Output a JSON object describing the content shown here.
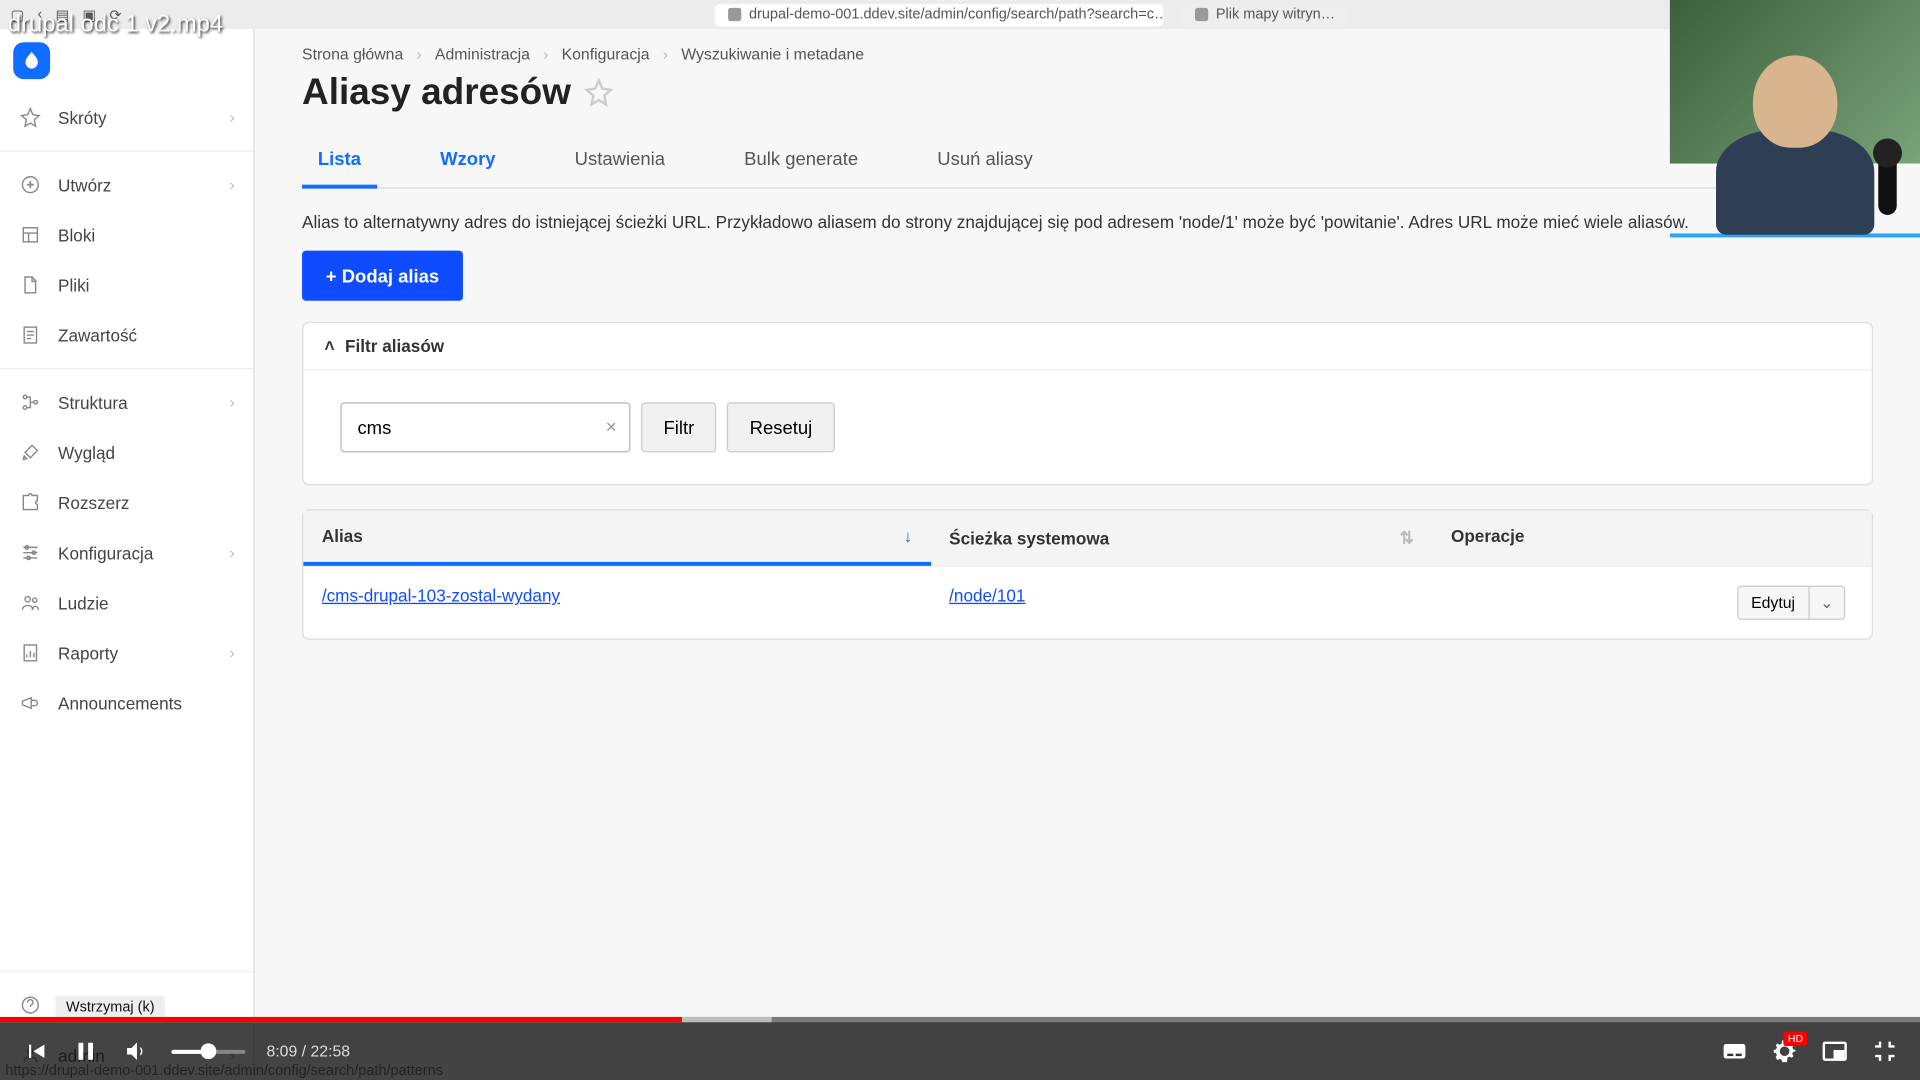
{
  "overlay_title": "drupal odc 1 v2.mp4",
  "browser_tabs": [
    {
      "label": "drupal-demo-001.ddev.site/admin/config/search/path?search=c…"
    },
    {
      "label": "Plik mapy witryn…"
    }
  ],
  "sidebar": {
    "items": [
      {
        "label": "Skróty",
        "has_chev": true,
        "icon": "star"
      },
      {
        "label": "Utwórz",
        "has_chev": true,
        "icon": "plus-circle"
      },
      {
        "label": "Bloki",
        "has_chev": false,
        "icon": "layout"
      },
      {
        "label": "Pliki",
        "has_chev": false,
        "icon": "file"
      },
      {
        "label": "Zawartość",
        "has_chev": false,
        "icon": "doc"
      },
      {
        "label": "Struktura",
        "has_chev": true,
        "icon": "tree"
      },
      {
        "label": "Wygląd",
        "has_chev": false,
        "icon": "brush"
      },
      {
        "label": "Rozszerz",
        "has_chev": false,
        "icon": "puzzle"
      },
      {
        "label": "Konfiguracja",
        "has_chev": true,
        "icon": "sliders"
      },
      {
        "label": "Ludzie",
        "has_chev": false,
        "icon": "users"
      },
      {
        "label": "Raporty",
        "has_chev": true,
        "icon": "report"
      },
      {
        "label": "Announcements",
        "has_chev": false,
        "icon": "megaphone"
      }
    ],
    "footer": [
      {
        "label": "Pomoc",
        "has_chev": false,
        "icon": "help"
      },
      {
        "label": "admin",
        "has_chev": true,
        "icon": "user"
      }
    ]
  },
  "breadcrumbs": [
    "Strona główna",
    "Administracja",
    "Konfiguracja",
    "Wyszukiwanie i metadane"
  ],
  "page_title": "Aliasy adresów",
  "tabs": [
    {
      "label": "Lista",
      "state": "active"
    },
    {
      "label": "Wzory",
      "state": "hover"
    },
    {
      "label": "Ustawienia",
      "state": ""
    },
    {
      "label": "Bulk generate",
      "state": ""
    },
    {
      "label": "Usuń aliasy",
      "state": ""
    }
  ],
  "description": "Alias to alternatywny adres do istniejącej ścieżki URL. Przykładowo aliasem do strony znajdującej się pod adresem 'node/1' może być 'powitanie'. Adres URL może mieć wiele aliasów.",
  "add_button": "+ Dodaj alias",
  "filter": {
    "title": "Filtr aliasów",
    "value": "cms",
    "filter_btn": "Filtr",
    "reset_btn": "Resetuj"
  },
  "table": {
    "headers": {
      "alias": "Alias",
      "system": "Ścieżka systemowa",
      "ops": "Operacje"
    },
    "rows": [
      {
        "alias": "/cms-drupal-103-zostal-wydany",
        "system": "/node/101",
        "op": "Edytuj"
      }
    ]
  },
  "video": {
    "tooltip": "Wstrzymaj (k)",
    "time_current": "8:09",
    "time_total": "22:58",
    "played_pct": 35.5,
    "buffer_pct": 40.2,
    "volume_pct": 50
  },
  "status_url": "https://drupal-demo-001.ddev.site/admin/config/search/path/patterns"
}
